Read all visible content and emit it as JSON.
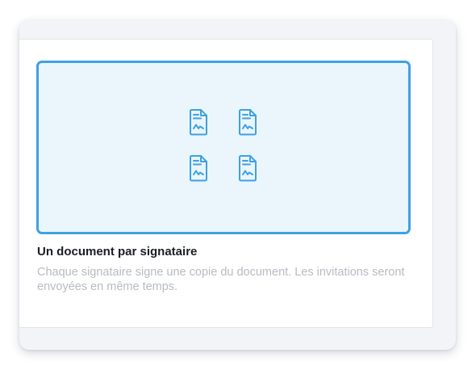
{
  "option": {
    "title": "Un document par signataire",
    "description": "Chaque signataire signe une copie du document. Les invitations seront envoyées en même temps.",
    "selected": true
  },
  "preview": {
    "icon": "signed-document-icon",
    "icon_count": 4
  },
  "colors": {
    "accent": "#3fa1e3",
    "preview_background": "#eaf5fc",
    "title": "#1a1d23",
    "description": "#b7bbc2"
  }
}
